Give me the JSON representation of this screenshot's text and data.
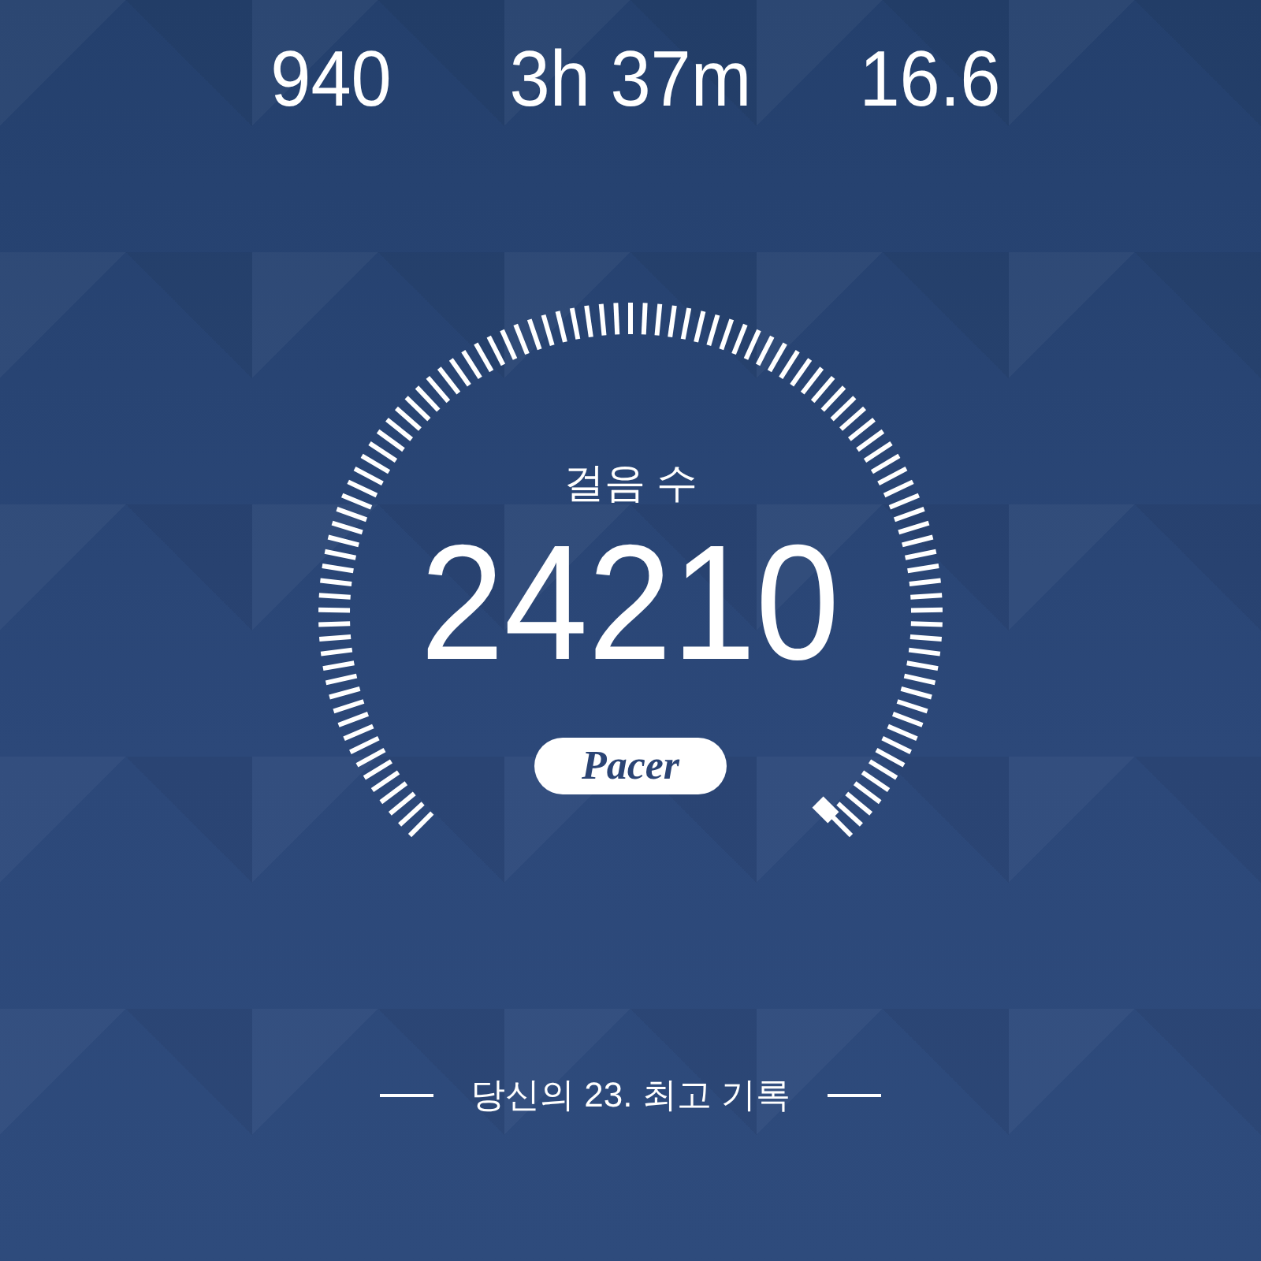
{
  "stats": [
    {
      "value": "940"
    },
    {
      "value": "3h 37m"
    },
    {
      "value": "16.6"
    }
  ],
  "gauge": {
    "label": "걸음 수",
    "value": "24210",
    "logo": "Pacer"
  },
  "footer": {
    "text": "당신의 23. 최고 기록"
  }
}
